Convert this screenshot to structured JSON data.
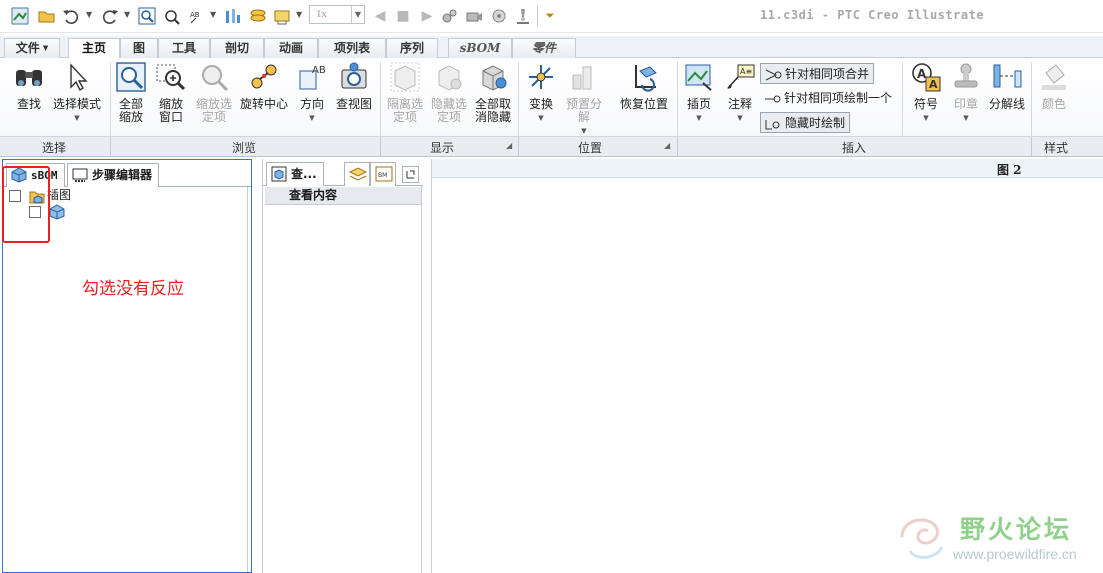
{
  "app": {
    "title": "11.c3di - PTC Creo Illustrate",
    "zoom_value": "1x"
  },
  "tabs": [
    {
      "label": "文件",
      "dropdown": true
    },
    {
      "label": "主页",
      "active": true
    },
    {
      "label": "图"
    },
    {
      "label": "工具"
    },
    {
      "label": "剖切"
    },
    {
      "label": "动画"
    },
    {
      "label": "项列表"
    },
    {
      "label": "序列"
    },
    {
      "label": "sBOM"
    },
    {
      "label": "零件"
    }
  ],
  "ribbon": {
    "find": "查找",
    "select_mode": "选择模式",
    "zoom_all": "全部缩放",
    "zoom_window": "缩放窗口",
    "zoom_selected": "缩放选定项",
    "rotate_center": "旋转中心",
    "orientation": "方向",
    "view_figure": "查视图",
    "isolate_selected": "隔离选定项",
    "hide_selected": "隐藏选定项",
    "unhide_all": "全部取消隐藏",
    "transform": "变换",
    "preset_explode": "预置分解",
    "restore_position": "恢复位置",
    "callout": "插页",
    "annotation": "注释",
    "merge_same_items": "针对相同项合并",
    "draw_same_item_one": "针对相同项绘制一个",
    "draw_when_hidden": "隐藏时绘制",
    "symbol": "符号",
    "stamp": "印章",
    "explode_line": "分解线",
    "color": "颜色"
  },
  "groups": {
    "select": "选择",
    "browse": "浏览",
    "display": "显示",
    "position": "位置",
    "insert": "插入",
    "style": "样式"
  },
  "left_panel": {
    "tab_sbom": "sBOM",
    "tab_step_editor": "步骤编辑器",
    "tree_root": "插图"
  },
  "annotation_text": "勾选没有反应",
  "middle_panel": {
    "tab_view": "查...",
    "column_header": "查看内容"
  },
  "viewport": {
    "title": "图 2"
  },
  "watermark": {
    "name": "野火论坛",
    "url": "www.proewildfire.cn"
  },
  "colors": {
    "annotation_red": "#e8231f",
    "panel_border_blue": "#3b6fd8",
    "watermark_green": "#8fd18a"
  }
}
